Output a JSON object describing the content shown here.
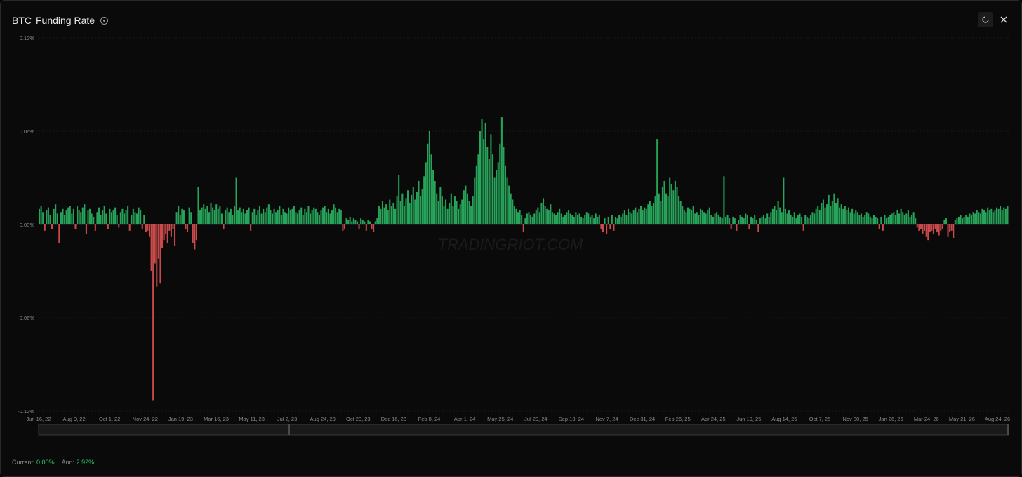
{
  "header": {
    "symbol": "BTC",
    "title": "Funding Rate",
    "info_icon": "info-circle-icon",
    "refresh_icon": "refresh-icon",
    "close_icon": "close-icon"
  },
  "watermark": "TRADINGRIOT.COM",
  "footer": {
    "current_label": "Current:",
    "current_value": "0.00%",
    "ann_label": "Ann:",
    "ann_value": "2.92%"
  },
  "colors": {
    "positive": "#27a35a",
    "negative": "#c94a4a",
    "background": "#0a0a0a",
    "text_value": "#2ecc71"
  },
  "chart_data": {
    "type": "bar",
    "title": "BTC Funding Rate",
    "xlabel": "",
    "ylabel": "",
    "ylim": [
      -0.12,
      0.12
    ],
    "yticks": [
      "0.12%",
      "0.06%",
      "0.00%",
      "-0.06%",
      "-0.12%"
    ],
    "yticks_values": [
      0.12,
      0.06,
      0.0,
      -0.06,
      -0.12
    ],
    "xticks": [
      "Jun 16, 22",
      "Aug 9, 22",
      "Oct 1, 22",
      "Nov 24, 22",
      "Jan 19, 23",
      "Mar 16, 23",
      "May 11, 23",
      "Jul 2, 23",
      "Aug 24, 23",
      "Oct 20, 23",
      "Dec 16, 23",
      "Feb 8, 24",
      "Apr 1, 24",
      "May 25, 24",
      "Jul 20, 24",
      "Sep 13, 24",
      "Nov 7, 24",
      "Dec 31, 24",
      "Feb 26, 25",
      "Apr 24, 25",
      "Jun 19, 25",
      "Aug 14, 25",
      "Oct 7, 25",
      "Nov 30, 25",
      "Jan 26, 26",
      "Mar 24, 26",
      "May 21, 26",
      "Aug 24, 26"
    ],
    "grid": false,
    "legend": "none",
    "series": [
      {
        "x_start": "Jun 16, 22",
        "x_end": "Aug 24, 26",
        "values": [
          0.01,
          0.012,
          0.008,
          -0.004,
          0.009,
          0.011,
          0.006,
          -0.003,
          0.01,
          0.013,
          0.007,
          -0.012,
          0.008,
          0.01,
          0.006,
          0.009,
          0.011,
          0.012,
          0.007,
          0.01,
          -0.003,
          0.012,
          0.009,
          0.008,
          0.011,
          0.013,
          -0.006,
          0.009,
          0.01,
          0.007,
          0.005,
          -0.004,
          0.008,
          0.011,
          0.006,
          0.009,
          0.012,
          0.007,
          -0.003,
          0.01,
          0.008,
          0.009,
          0.011,
          0.006,
          -0.002,
          0.008,
          0.01,
          0.007,
          0.009,
          0.012,
          -0.004,
          0.006,
          0.01,
          0.008,
          0.007,
          0.011,
          0.009,
          -0.003,
          0.006,
          -0.005,
          -0.004,
          -0.008,
          -0.03,
          -0.113,
          -0.025,
          -0.04,
          -0.022,
          -0.038,
          -0.015,
          -0.01,
          -0.006,
          -0.012,
          -0.004,
          -0.008,
          -0.003,
          -0.014,
          0.008,
          0.012,
          0.006,
          0.01,
          0.009,
          -0.003,
          -0.005,
          0.011,
          0.008,
          -0.012,
          -0.016,
          -0.01,
          0.024,
          0.009,
          0.011,
          0.013,
          0.01,
          0.012,
          0.008,
          0.014,
          0.011,
          0.009,
          0.013,
          0.01,
          0.012,
          0.007,
          -0.003,
          0.009,
          0.011,
          0.008,
          0.01,
          0.006,
          0.012,
          0.03,
          0.009,
          0.011,
          0.008,
          0.01,
          0.007,
          0.009,
          0.011,
          -0.004,
          0.008,
          0.01,
          0.006,
          0.009,
          0.012,
          0.007,
          0.01,
          0.008,
          0.011,
          0.013,
          0.009,
          0.007,
          0.01,
          0.008,
          0.009,
          0.012,
          0.006,
          0.01,
          0.008,
          0.007,
          0.011,
          0.009,
          0.01,
          0.012,
          0.008,
          0.007,
          0.009,
          0.011,
          0.006,
          0.01,
          0.008,
          0.012,
          0.007,
          0.009,
          0.011,
          0.01,
          0.008,
          0.006,
          0.009,
          0.011,
          0.012,
          0.008,
          0.01,
          0.007,
          0.009,
          0.013,
          0.011,
          0.008,
          0.01,
          0.009,
          -0.004,
          -0.003,
          0.004,
          0.003,
          0.005,
          0.002,
          0.004,
          0.003,
          0.002,
          -0.003,
          0.004,
          0.003,
          0.002,
          -0.004,
          0.003,
          0.002,
          -0.003,
          -0.005,
          0.002,
          0.004,
          0.012,
          0.01,
          0.015,
          0.011,
          0.013,
          0.009,
          0.016,
          0.012,
          0.014,
          0.01,
          0.018,
          0.032,
          0.015,
          0.02,
          0.012,
          0.017,
          0.022,
          0.014,
          0.019,
          0.024,
          0.016,
          0.021,
          0.028,
          0.018,
          0.023,
          0.031,
          0.04,
          0.052,
          0.06,
          0.045,
          0.035,
          0.028,
          0.02,
          0.015,
          0.024,
          0.018,
          0.012,
          0.016,
          0.01,
          0.014,
          0.02,
          0.012,
          0.018,
          0.015,
          0.01,
          0.013,
          0.016,
          0.022,
          0.025,
          0.02,
          0.015,
          0.012,
          0.018,
          0.03,
          0.038,
          0.045,
          0.06,
          0.068,
          0.055,
          0.065,
          0.05,
          0.042,
          0.058,
          0.045,
          0.03,
          0.035,
          0.04,
          0.052,
          0.069,
          0.05,
          0.038,
          0.03,
          0.025,
          0.02,
          0.016,
          0.012,
          0.01,
          0.008,
          0.009,
          0.006,
          -0.005,
          0.004,
          0.007,
          0.008,
          0.006,
          0.005,
          0.007,
          0.009,
          0.011,
          0.008,
          0.014,
          0.017,
          0.012,
          0.01,
          0.009,
          0.013,
          0.008,
          0.007,
          0.006,
          0.008,
          0.01,
          0.007,
          0.005,
          0.006,
          0.008,
          0.009,
          0.007,
          0.006,
          0.005,
          0.008,
          0.006,
          0.007,
          0.005,
          0.004,
          0.006,
          0.008,
          0.007,
          0.005,
          0.006,
          0.004,
          0.007,
          0.005,
          0.006,
          -0.003,
          -0.005,
          0.004,
          -0.006,
          0.005,
          -0.003,
          0.006,
          -0.004,
          0.005,
          0.004,
          0.006,
          0.005,
          0.007,
          0.009,
          0.006,
          0.01,
          0.008,
          0.007,
          0.009,
          0.011,
          0.008,
          0.01,
          0.012,
          0.009,
          0.011,
          0.01,
          0.013,
          0.015,
          0.012,
          0.014,
          0.018,
          0.055,
          0.02,
          0.015,
          0.024,
          0.028,
          0.02,
          0.018,
          0.03,
          0.026,
          0.022,
          0.028,
          0.024,
          0.018,
          0.015,
          0.012,
          0.009,
          0.008,
          0.011,
          0.01,
          0.009,
          0.012,
          0.007,
          0.008,
          0.006,
          0.01,
          0.009,
          0.008,
          0.007,
          0.009,
          0.011,
          0.006,
          0.005,
          0.007,
          0.008,
          0.006,
          0.005,
          0.004,
          0.031,
          0.005,
          0.006,
          0.004,
          -0.003,
          0.005,
          0.004,
          -0.004,
          0.003,
          0.006,
          0.005,
          0.004,
          0.007,
          0.006,
          -0.003,
          0.005,
          0.004,
          0.006,
          0.003,
          -0.005,
          0.004,
          0.005,
          0.006,
          0.004,
          0.007,
          0.005,
          0.008,
          0.01,
          0.012,
          0.009,
          0.015,
          0.011,
          0.008,
          0.03,
          0.01,
          0.007,
          0.009,
          0.006,
          0.005,
          0.008,
          0.004,
          0.006,
          0.007,
          0.005,
          -0.004,
          0.006,
          0.005,
          0.004,
          0.006,
          0.008,
          0.007,
          0.01,
          0.012,
          0.009,
          0.014,
          0.016,
          0.011,
          0.013,
          0.019,
          0.012,
          0.015,
          0.02,
          0.014,
          0.017,
          0.011,
          0.013,
          0.01,
          0.012,
          0.009,
          0.011,
          0.008,
          0.01,
          0.007,
          0.009,
          0.008,
          0.006,
          0.007,
          0.005,
          0.006,
          0.008,
          0.007,
          0.005,
          0.004,
          0.006,
          0.005,
          0.004,
          -0.003,
          0.005,
          -0.004,
          0.006,
          0.004,
          0.005,
          0.006,
          0.007,
          0.008,
          0.006,
          0.009,
          0.007,
          0.01,
          0.008,
          0.006,
          0.007,
          0.009,
          0.005,
          0.006,
          0.008,
          0.004,
          -0.002,
          -0.004,
          -0.003,
          -0.006,
          -0.004,
          -0.008,
          -0.01,
          -0.005,
          -0.004,
          -0.006,
          -0.003,
          -0.005,
          -0.007,
          -0.004,
          -0.003,
          0.003,
          0.004,
          -0.008,
          -0.005,
          -0.004,
          -0.009,
          0.003,
          0.004,
          0.005,
          0.006,
          0.004,
          0.005,
          0.006,
          0.005,
          0.007,
          0.006,
          0.008,
          0.007,
          0.009,
          0.008,
          0.007,
          0.01,
          0.009,
          0.008,
          0.011,
          0.009,
          0.01,
          0.008,
          0.009,
          0.011,
          0.01,
          0.012,
          0.009,
          0.011,
          0.01,
          0.012
        ]
      }
    ]
  }
}
